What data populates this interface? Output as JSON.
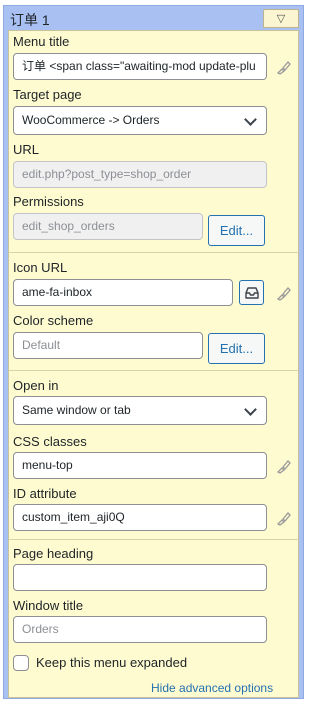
{
  "window": {
    "title": "订单 1",
    "toggle_icon": "▽"
  },
  "fields": {
    "menu_title": {
      "label": "Menu title",
      "value": "订单 <span class=\"awaiting-mod update-plu"
    },
    "target_page": {
      "label": "Target page",
      "value": "WooCommerce -> Orders"
    },
    "url": {
      "label": "URL",
      "value": "edit.php?post_type=shop_order"
    },
    "permissions": {
      "label": "Permissions",
      "value": "edit_shop_orders",
      "edit_label": "Edit..."
    },
    "icon_url": {
      "label": "Icon URL",
      "value": "ame-fa-inbox"
    },
    "color_scheme": {
      "label": "Color scheme",
      "placeholder": "Default",
      "edit_label": "Edit..."
    },
    "open_in": {
      "label": "Open in",
      "value": "Same window or tab"
    },
    "css_classes": {
      "label": "CSS classes",
      "value": "menu-top"
    },
    "id_attribute": {
      "label": "ID attribute",
      "value": "custom_item_aji0Q"
    },
    "page_heading": {
      "label": "Page heading",
      "value": ""
    },
    "window_title": {
      "label": "Window title",
      "placeholder": "Orders"
    },
    "keep_expanded": {
      "label": "Keep this menu expanded",
      "checked": false
    }
  },
  "links": {
    "hide_advanced": "Hide advanced options"
  },
  "icons": {
    "reset": "paintbrush-icon",
    "inbox": "inbox-icon",
    "toggle": "triangle-down-icon"
  },
  "colors": {
    "header": "#a9c0f3",
    "panel": "#fffbd0",
    "accent": "#2271b1"
  }
}
